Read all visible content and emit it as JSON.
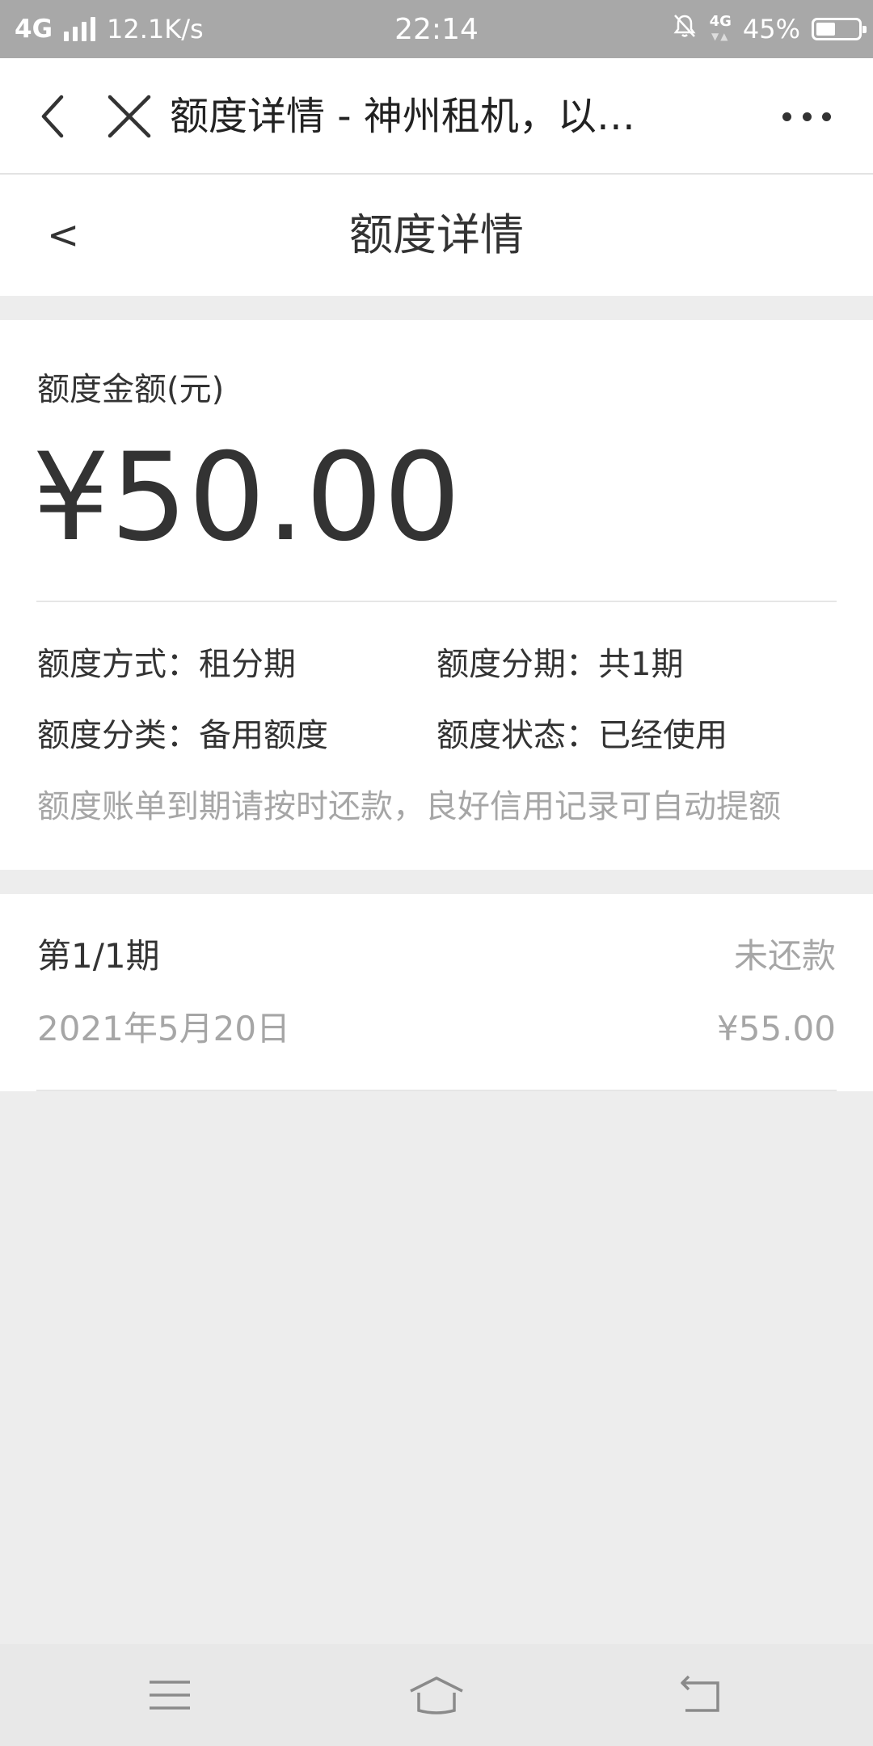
{
  "status_bar": {
    "network": "4G",
    "speed": "12.1K/s",
    "time": "22:14",
    "network_small": "4G",
    "battery": "45%",
    "battery_level": 0.45,
    "icons": [
      "signal-icon",
      "bell-muted-icon",
      "battery-icon"
    ]
  },
  "nav_bar": {
    "title": "额度详情 - 神州租机，以…",
    "icons": [
      "back-icon",
      "close-icon",
      "more-icon"
    ]
  },
  "page_header": {
    "back_label": "<",
    "title": "额度详情"
  },
  "quota": {
    "amount_label": "额度金额(元)",
    "amount": "¥50.00",
    "fields": [
      {
        "label": "额度方式：",
        "value": "租分期"
      },
      {
        "label": "额度分期：",
        "value": "共1期"
      },
      {
        "label": "额度分类：",
        "value": "备用额度"
      },
      {
        "label": "额度状态：",
        "value": "已经使用"
      }
    ],
    "note": "额度账单到期请按时还款，良好信用记录可自动提额"
  },
  "installment": {
    "period": "第1/1期",
    "status": "未还款",
    "date": "2021年5月20日",
    "amount": "¥55.00"
  },
  "bottom_nav": {
    "icons": [
      "menu-icon",
      "home-icon",
      "return-icon"
    ]
  },
  "colors": {
    "status_bar_bg": "#a8a8a8",
    "page_bg": "#ededed",
    "card_bg": "#ffffff",
    "text_primary": "#333333",
    "text_secondary": "#a6a6a6"
  }
}
